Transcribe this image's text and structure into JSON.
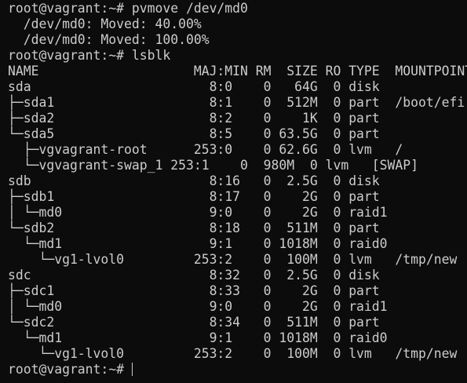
{
  "terminal": {
    "lines": [
      "root@vagrant:~# pvmove /dev/md0",
      "  /dev/md0: Moved: 40.00%",
      "  /dev/md0: Moved: 100.00%",
      "root@vagrant:~# lsblk",
      "NAME                    MAJ:MIN RM  SIZE RO TYPE  MOUNTPOINT",
      "sda                       8:0    0   64G  0 disk",
      "├─sda1                    8:1    0  512M  0 part  /boot/efi",
      "├─sda2                    8:2    0    1K  0 part",
      "└─sda5                    8:5    0 63.5G  0 part",
      "  ├─vgvagrant-root      253:0    0 62.6G  0 lvm   /",
      "  └─vgvagrant-swap_1 253:1    0  980M  0 lvm   [SWAP]",
      "sdb                       8:16   0  2.5G  0 disk",
      "├─sdb1                    8:17   0    2G  0 part",
      "│ └─md0                   9:0    0    2G  0 raid1",
      "└─sdb2                    8:18   0  511M  0 part",
      "  └─md1                   9:1    0 1018M  0 raid0",
      "    └─vg1-lvol0         253:2    0  100M  0 lvm   /tmp/new",
      "sdc                       8:32   0  2.5G  0 disk",
      "├─sdc1                    8:33   0    2G  0 part",
      "│ └─md0                   9:0    0    2G  0 raid1",
      "└─sdc2                    8:34   0  511M  0 part",
      "  └─md1                   9:1    0 1018M  0 raid0",
      "    └─vg1-lvol0         253:2    0  100M  0 lvm   /tmp/new"
    ],
    "prompt": "root@vagrant:~# ",
    "colors": {
      "background": "#0c0c0c",
      "foreground": "#cccccc"
    }
  }
}
